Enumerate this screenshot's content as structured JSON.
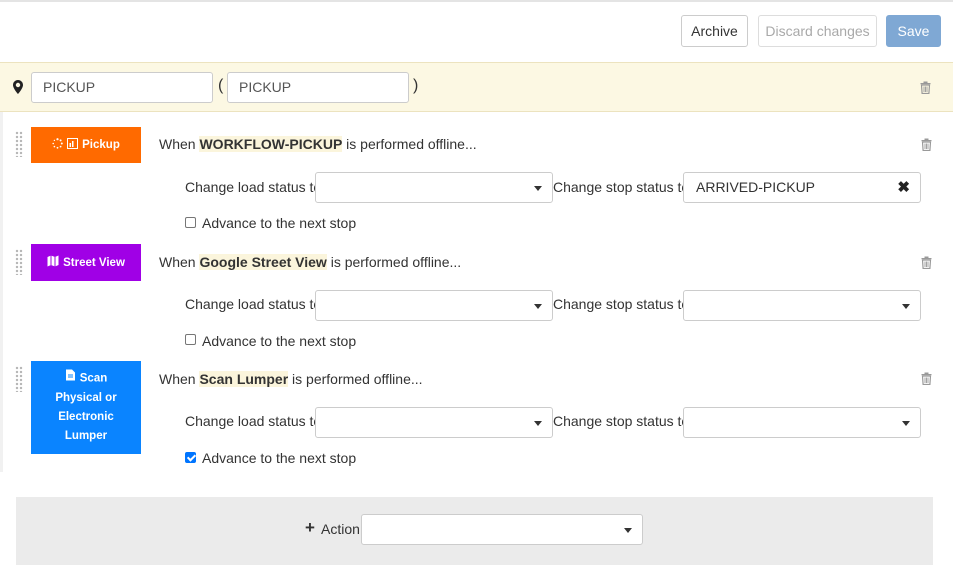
{
  "toolbar": {
    "archive_label": "Archive",
    "discard_label": "Discard changes",
    "save_label": "Save"
  },
  "stop": {
    "name_value": "PICKUP",
    "code_value": "PICKUP",
    "open_paren": "(",
    "close_paren": ")"
  },
  "rules": [
    {
      "chip_label": "Pickup",
      "chip_color": "#ff6a00",
      "when_prefix": "When ",
      "workflow": "WORKFLOW-PICKUP",
      "when_suffix": " is performed offline...",
      "load_label": "Change load status to",
      "load_value": "",
      "stop_label": "Change stop status to",
      "stop_value": "ARRIVED-PICKUP",
      "advance_label": "Advance to the next stop",
      "advance_checked": false
    },
    {
      "chip_label": "Street View",
      "chip_color": "#a000e6",
      "when_prefix": "When ",
      "workflow": "Google Street View",
      "when_suffix": " is performed offline...",
      "load_label": "Change load status to",
      "load_value": "",
      "stop_label": "Change stop status to",
      "stop_value": "",
      "advance_label": "Advance to the next stop",
      "advance_checked": false
    },
    {
      "chip_label": "Scan Physical or Electronic Lumper",
      "chip_color": "#0a84ff",
      "when_prefix": "When ",
      "workflow": "Scan Lumper",
      "when_suffix": " is performed offline...",
      "load_label": "Change load status to",
      "load_value": "",
      "stop_label": "Change stop status to",
      "stop_value": "",
      "advance_label": "Advance to the next stop",
      "advance_checked": true
    }
  ],
  "add_action": {
    "plus": "+",
    "label": "Action",
    "value": ""
  },
  "icons": {
    "pin": "map-marker-icon",
    "trash": "trash-icon",
    "drag": "drag-handle-icon",
    "caret": "caret-down-icon",
    "clear": "clear-x-icon"
  }
}
